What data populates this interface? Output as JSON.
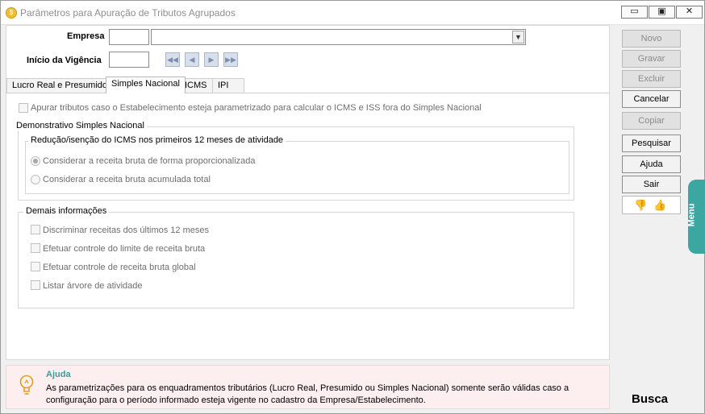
{
  "window": {
    "title": "Parâmetros para Apuração de Tributos Agrupados",
    "icon": "coin-icon",
    "controls": {
      "minimize": "▭",
      "maximize": "▣",
      "close": "✕"
    }
  },
  "header": {
    "empresa_label": "Empresa",
    "empresa_code": "",
    "empresa_name": "",
    "vigencia_label": "Início da Vigência",
    "vigencia_value": ""
  },
  "tabs": [
    {
      "label": "Lucro Real e Presumido",
      "active": false
    },
    {
      "label": "Simples Nacional",
      "active": true
    },
    {
      "label": "ICMS",
      "active": false
    },
    {
      "label": "IPI",
      "active": false
    }
  ],
  "simples": {
    "apurar_label": "Apurar tributos caso o Estabelecimento esteja parametrizado para calcular o ICMS e ISS fora do Simples Nacional",
    "demonstrativo_title": "Demonstrativo Simples Nacional",
    "reducao_title": "Redução/isenção do ICMS nos primeiros 12 meses de atividade",
    "radio_proporcional": "Considerar a receita bruta de forma proporcionalizada",
    "radio_acumulada": "Considerar a receita bruta acumulada total",
    "demais_title": "Demais informações",
    "chk_discriminar": "Discriminar receitas dos últimos 12 meses",
    "chk_limite": "Efetuar controle do limite de receita bruta",
    "chk_global": "Efetuar controle de receita bruta global",
    "chk_arvore": "Listar árvore de atividade"
  },
  "actions": {
    "novo": "Novo",
    "gravar": "Gravar",
    "excluir": "Excluir",
    "cancelar": "Cancelar",
    "copiar": "Copiar",
    "pesquisar": "Pesquisar",
    "ajuda": "Ajuda",
    "sair": "Sair"
  },
  "menu_tab": "Menu",
  "help": {
    "title": "Ajuda",
    "text": "As parametrizações para os enquadramentos tributários (Lucro Real, Presumido ou Simples Nacional) somente serão válidas caso a configuração para o período informado esteja vigente no cadastro da Empresa/Estabelecimento."
  },
  "busca": "Busca",
  "colors": {
    "accent": "#3ba7a0",
    "help_bg": "#fdeef0",
    "help_title": "#3a9c93"
  }
}
